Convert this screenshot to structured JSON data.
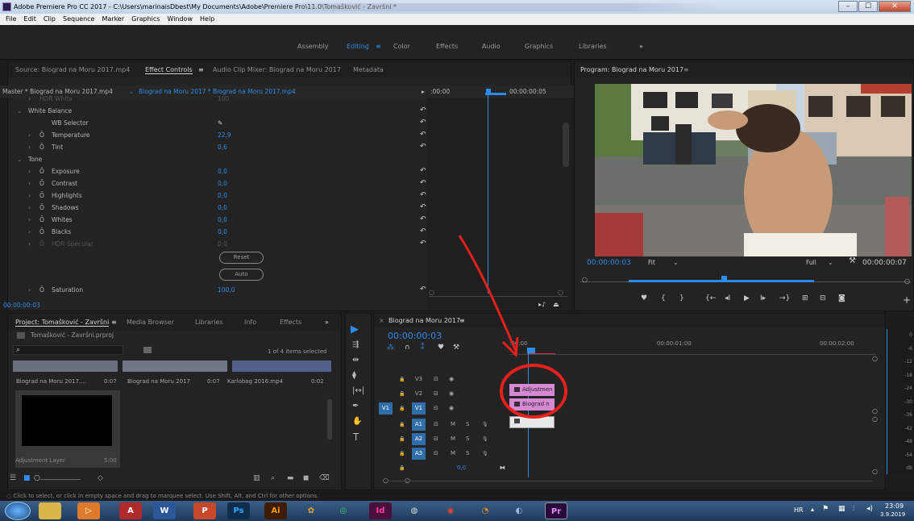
{
  "window": {
    "title": "Adobe Premiere Pro CC 2017 - C:\\Users\\marinaisDbest\\My Documents\\Adobe\\Premiere Pro\\11.0\\Tomašković - Završni *",
    "min_label": "–",
    "max_label": "☐",
    "close_label": "✕"
  },
  "menu": [
    "File",
    "Edit",
    "Clip",
    "Sequence",
    "Marker",
    "Graphics",
    "Window",
    "Help"
  ],
  "workspaces": {
    "tabs": [
      "Assembly",
      "Editing",
      "Color",
      "Effects",
      "Audio",
      "Graphics",
      "Libraries"
    ],
    "active": "Editing",
    "menu_glyph": "≡",
    "more": "»"
  },
  "source_panel": {
    "tabs": [
      "Source: Biograd na Moru 2017.mp4",
      "Effect Controls",
      "Audio Clip Mixer: Biograd na Moru 2017",
      "Metadata"
    ],
    "menu_glyph": "≡",
    "master": "Master * Biograd na Moru 2017.mp4",
    "sequence_clip": "Biograd na Moru 2017 * Biograd na Moru 2017.mp4",
    "ruler_start": ":00:00",
    "ruler_mark": "00:00:00:05",
    "rows": [
      {
        "label": "HDR White",
        "value": "100",
        "dim": true,
        "indent": 2
      },
      {
        "label": "White Balance",
        "value": "",
        "section": true,
        "indent": 1
      },
      {
        "label": "WB Selector",
        "value": "",
        "indent": 3,
        "eyedropper": true
      },
      {
        "label": "Temperature",
        "value": "22,9",
        "indent": 2,
        "stopwatch": true
      },
      {
        "label": "Tint",
        "value": "0,6",
        "indent": 2,
        "stopwatch": true
      },
      {
        "label": "Tone",
        "value": "",
        "section": true,
        "indent": 1
      },
      {
        "label": "Exposure",
        "value": "0,0",
        "indent": 2,
        "stopwatch": true
      },
      {
        "label": "Contrast",
        "value": "0,0",
        "indent": 2,
        "stopwatch": true
      },
      {
        "label": "Highlights",
        "value": "0,0",
        "indent": 2,
        "stopwatch": true
      },
      {
        "label": "Shadows",
        "value": "0,0",
        "indent": 2,
        "stopwatch": true
      },
      {
        "label": "Whites",
        "value": "0,0",
        "indent": 2,
        "stopwatch": true
      },
      {
        "label": "Blacks",
        "value": "0,0",
        "indent": 2,
        "stopwatch": true
      },
      {
        "label": "HDR Specular",
        "value": "0,0",
        "dim": true,
        "indent": 2,
        "stopwatch": true
      }
    ],
    "reset_button": "Reset",
    "auto_button": "Auto",
    "saturation_label": "Saturation",
    "saturation_value": "100,0",
    "timecode": "00:00:00:03"
  },
  "program_monitor": {
    "title": "Program: Biograd na Moru 2017",
    "menu_glyph": "≡",
    "timecode": "00:00:00:03",
    "fit": "Fit",
    "quality": "Full",
    "duration": "00:00:00:07",
    "controls": [
      "marker",
      "in",
      "out",
      "go-in",
      "step-back",
      "play",
      "step-forward",
      "go-out",
      "lift",
      "extract",
      "export-frame",
      "add"
    ]
  },
  "project_panel": {
    "tabs": [
      "Project: Tomašković - Završni",
      "Media Browser",
      "Libraries",
      "Info",
      "Effects"
    ],
    "menu_glyph": "≡",
    "more": "»",
    "project_file": "Tomašković - Završni.prproj",
    "items_selected": "1 of 4 items selected",
    "items": [
      {
        "name": "Biograd na Moru 2017....",
        "duration": "0:07"
      },
      {
        "name": "Biograd na Moru 2017",
        "duration": "0:07"
      },
      {
        "name": "Karlobag 2016.mp4",
        "duration": "0:02"
      }
    ],
    "adjustment_layer": {
      "name": "Adjustment Layer",
      "duration": "5:00"
    }
  },
  "timeline": {
    "title": "Biograd na Moru 2017",
    "menu_glyph": "≡",
    "timecode": "00:00:00:03",
    "ruler": [
      ":00:00",
      "00:00:01:00",
      "00:00:02:00"
    ],
    "video_tracks": [
      "V3",
      "V2",
      "V1"
    ],
    "audio_tracks": [
      "A1",
      "A2",
      "A3"
    ],
    "source_patch_video": "V1",
    "master_value": "0,0",
    "clips": [
      {
        "label": "Adjustmen",
        "track": "V2"
      },
      {
        "label": "Biograd n",
        "track": "V1"
      }
    ],
    "meter_labels": [
      "0",
      "-6",
      "-12",
      "-18",
      "-24",
      "-30",
      "-36",
      "-42",
      "-48",
      "-54",
      "dB"
    ]
  },
  "status": "Click to select, or click in empty space and drag to marquee select. Use Shift, Alt, and Ctrl for other options.",
  "taskbar": {
    "lang": "HR",
    "time": "23:09",
    "date": "3.9.2019",
    "apps": [
      "start",
      "explorer",
      "media",
      "access",
      "word",
      "powerpoint",
      "photoshop",
      "illustrator",
      "bridge",
      "chrome-audio",
      "indesign",
      "vlc-ish",
      "chrome",
      "firefox",
      "paint",
      "premiere"
    ]
  },
  "colors": {
    "accent_blue": "#2d8ceb",
    "annotation_red": "#e8201c",
    "clip_pink": "#d68ad3"
  }
}
